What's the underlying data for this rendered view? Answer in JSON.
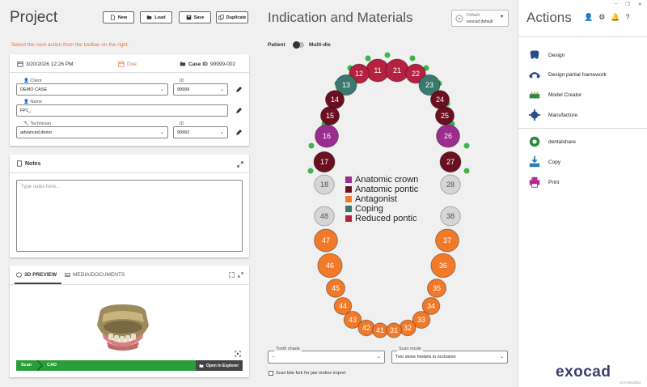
{
  "header": {
    "project_title": "Project",
    "buttons": {
      "new": "New",
      "load": "Load",
      "save": "Save",
      "duplicate": "Duplicate"
    },
    "instruction": "Select the next action from the toolbar on the right."
  },
  "case": {
    "date": "3/20/2026 12:26 PM",
    "due_label": "Due",
    "case_id_label": "Case ID",
    "case_id": "99999-002",
    "client_label": "Client",
    "client_value": "DEMO CASE",
    "client_id_label": "ID",
    "client_id": "99999",
    "name_label": "Name",
    "name_value": "FP1_",
    "technician_label": "Technician",
    "technician_value": "advanced,demo",
    "technician_id_label": "ID",
    "technician_id": "99992"
  },
  "notes": {
    "title": "Notes",
    "placeholder": "Type notes here..."
  },
  "preview": {
    "tab_3d": "3D PREVIEW",
    "tab_media": "MEDIA/DOCUMENTS",
    "progress_steps": [
      "Scan",
      "CAD"
    ],
    "open_in_explorer": "Open in Explorer"
  },
  "center": {
    "title": "Indication and Materials",
    "profile_label": "Default",
    "profile_value": "exocad default",
    "toggle_left": "Patient",
    "toggle_right": "Multi-die",
    "legend": [
      {
        "label": "Anatomic crown",
        "color": "#9b2d8f"
      },
      {
        "label": "Anatomic pontic",
        "color": "#6b1021"
      },
      {
        "label": "Antagonist",
        "color": "#f07a2a"
      },
      {
        "label": "Coping",
        "color": "#3a7a6e"
      },
      {
        "label": "Reduced pontic",
        "color": "#b5213f"
      }
    ],
    "tooth_shade_label": "Tooth shade",
    "tooth_shade_value": "--",
    "scan_mode_label": "Scan mode",
    "scan_mode_value": "Two stone models in occlusion",
    "bite_fork_label": "Scan bite fork for jaw motion import"
  },
  "teeth": [
    {
      "num": "11",
      "type": "reduced"
    },
    {
      "num": "21",
      "type": "reduced"
    },
    {
      "num": "12",
      "type": "reduced"
    },
    {
      "num": "22",
      "type": "reduced"
    },
    {
      "num": "13",
      "type": "coping"
    },
    {
      "num": "23",
      "type": "coping"
    },
    {
      "num": "14",
      "type": "pontic"
    },
    {
      "num": "24",
      "type": "pontic"
    },
    {
      "num": "15",
      "type": "pontic"
    },
    {
      "num": "25",
      "type": "pontic"
    },
    {
      "num": "16",
      "type": "crown"
    },
    {
      "num": "26",
      "type": "crown"
    },
    {
      "num": "17",
      "type": "pontic"
    },
    {
      "num": "27",
      "type": "pontic"
    },
    {
      "num": "18",
      "type": "none"
    },
    {
      "num": "28",
      "type": "none"
    },
    {
      "num": "48",
      "type": "none"
    },
    {
      "num": "38",
      "type": "none"
    },
    {
      "num": "47",
      "type": "antagonist"
    },
    {
      "num": "37",
      "type": "antagonist"
    },
    {
      "num": "46",
      "type": "antagonist"
    },
    {
      "num": "36",
      "type": "antagonist"
    },
    {
      "num": "45",
      "type": "antagonist"
    },
    {
      "num": "35",
      "type": "antagonist"
    },
    {
      "num": "44",
      "type": "antagonist"
    },
    {
      "num": "34",
      "type": "antagonist"
    },
    {
      "num": "43",
      "type": "antagonist"
    },
    {
      "num": "33",
      "type": "antagonist"
    },
    {
      "num": "42",
      "type": "antagonist"
    },
    {
      "num": "32",
      "type": "antagonist"
    },
    {
      "num": "41",
      "type": "antagonist"
    },
    {
      "num": "31",
      "type": "antagonist"
    }
  ],
  "actions": {
    "title": "Actions",
    "items": [
      "Design",
      "Design partial framework",
      "Model Creator",
      "Manufacture"
    ],
    "items2": [
      "dentalshare",
      "Copy",
      "Print"
    ]
  },
  "brand": {
    "logo": "exocad",
    "version": "v3.0-9512/64"
  }
}
